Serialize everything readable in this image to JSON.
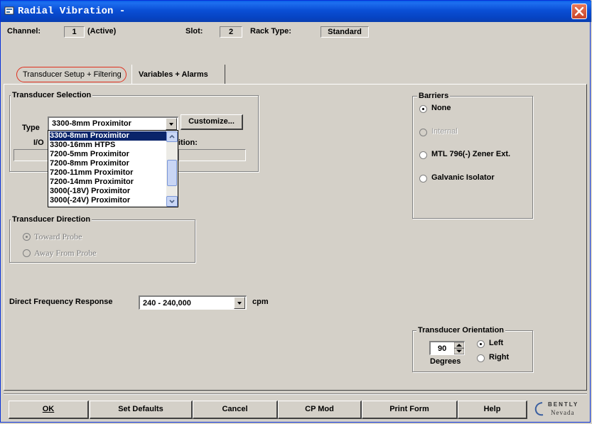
{
  "window": {
    "title": "Radial Vibration -"
  },
  "header": {
    "channel_label": "Channel:",
    "channel_value": "1",
    "channel_status": "(Active)",
    "slot_label": "Slot:",
    "slot_value": "2",
    "rack_type_label": "Rack Type:",
    "rack_type_value": "Standard"
  },
  "tabs": [
    {
      "label": "Transducer Setup + Filtering",
      "active": true
    },
    {
      "label": "Variables + Alarms",
      "active": false
    }
  ],
  "transducer_selection": {
    "legend": "Transducer Selection",
    "type_label": "Type",
    "type_value": "3300-8mm Proximitor",
    "customize_label": "Customize...",
    "io_label_partial": "I/O",
    "position_label_partial": "ition:",
    "dropdown_options": [
      "3300-8mm Proximitor",
      "3300-16mm HTPS",
      "7200-5mm Proximitor",
      "7200-8mm Proximitor",
      "7200-11mm Proximitor",
      "7200-14mm Proximitor",
      "3000(-18V) Proximitor",
      "3000(-24V) Proximitor"
    ],
    "selected_option": "3300-8mm Proximitor"
  },
  "barriers": {
    "legend": "Barriers",
    "options": [
      {
        "label": "None",
        "checked": true,
        "enabled": true
      },
      {
        "label": "Internal",
        "checked": false,
        "enabled": false
      },
      {
        "label": "MTL 796(-) Zener Ext.",
        "checked": false,
        "enabled": true
      },
      {
        "label": "Galvanic Isolator",
        "checked": false,
        "enabled": true
      }
    ]
  },
  "transducer_direction": {
    "legend": "Transducer Direction",
    "options": [
      {
        "label": "Toward Probe",
        "checked": true,
        "enabled": false
      },
      {
        "label": "Away From Probe",
        "checked": false,
        "enabled": false
      }
    ]
  },
  "frequency": {
    "label": "Direct Frequency Response",
    "value": "240 - 240,000",
    "unit": "cpm"
  },
  "orientation": {
    "legend": "Transducer Orientation",
    "degrees_value": "90",
    "degrees_label": "Degrees",
    "options": [
      {
        "label": "Left",
        "checked": true
      },
      {
        "label": "Right",
        "checked": false
      }
    ]
  },
  "footer": {
    "buttons": [
      "OK",
      "Set Defaults",
      "Cancel",
      "CP Mod",
      "Print Form",
      "Help"
    ],
    "logo_top": "BENTLY",
    "logo_bottom": "Nevada"
  },
  "colors": {
    "titlebar": "#0a4fd6",
    "selection": "#0a246a",
    "face": "#d4d0c8",
    "tab_highlight": "#e0301e"
  }
}
